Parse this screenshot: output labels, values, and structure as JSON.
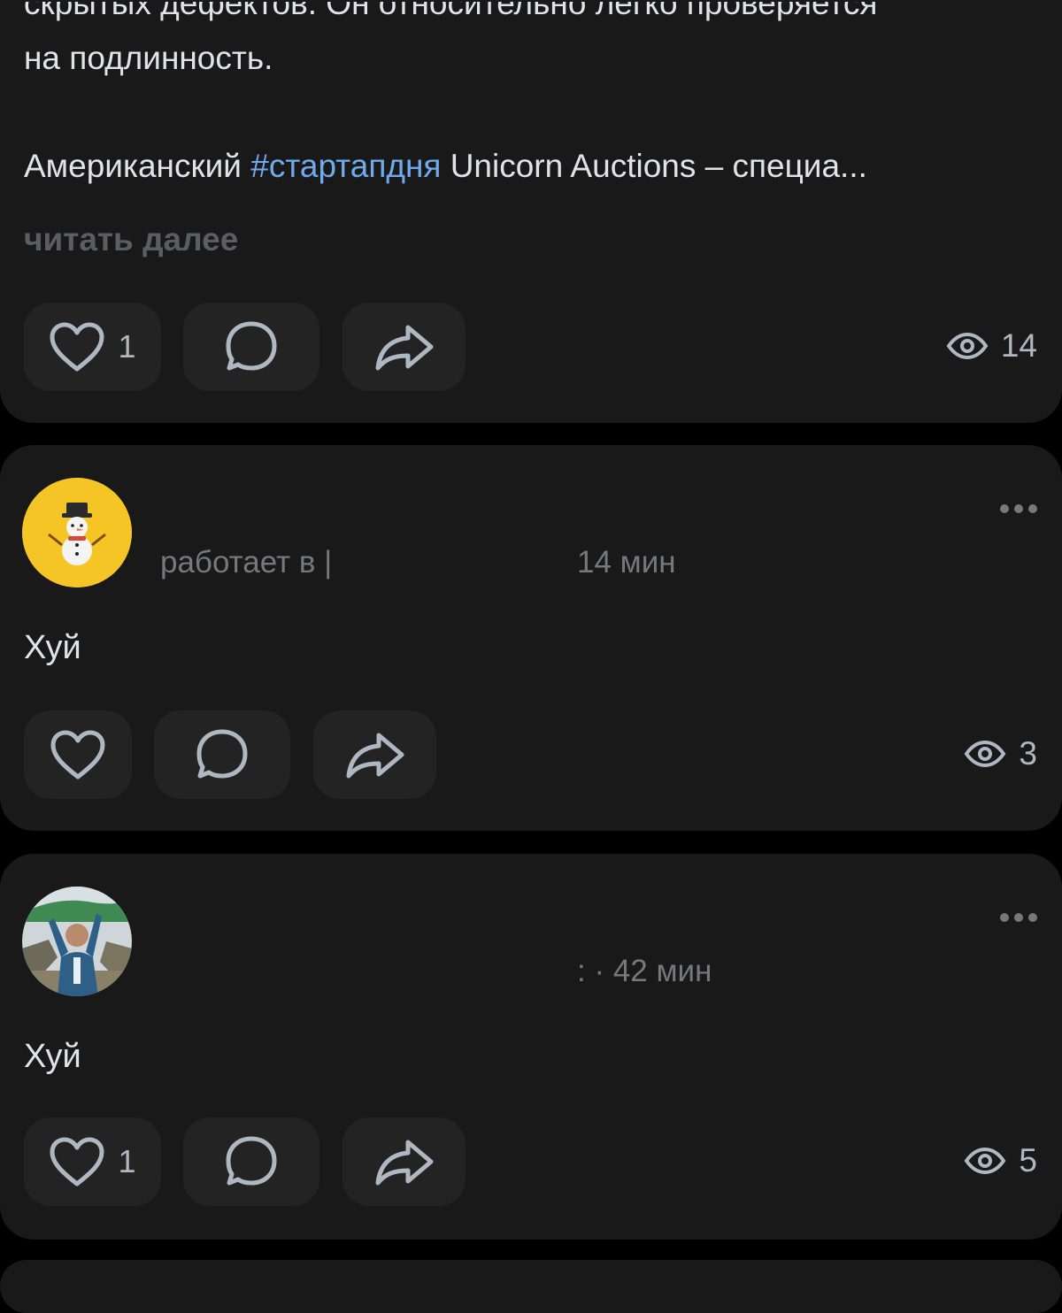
{
  "posts": [
    {
      "text_line_partial": "скрытых дефектов. Он относительно легко проверяется",
      "text_line1": "на подлинность.",
      "text_line2_before": "Американский ",
      "hashtag": "#стартапдня",
      "text_line2_after": " Unicorn Auctions – специа...",
      "read_more": "читать далее",
      "likes": "1",
      "views": "14"
    },
    {
      "meta_status": "работает в |",
      "meta_time": "14 мин",
      "text": "Хуй",
      "likes": "",
      "views": "3"
    },
    {
      "meta_time": ": · 42 мин",
      "text": "Хуй",
      "likes": "1",
      "views": "5"
    }
  ],
  "icons": {
    "like": "heart-outline-icon",
    "comment": "comment-bubble-icon",
    "share": "share-arrow-icon",
    "views": "eye-icon",
    "more": "more-dots-icon"
  },
  "colors": {
    "background": "#000000",
    "card": "#19191a",
    "button": "#232324",
    "text": "#e1e3e6",
    "secondary_text": "#76787a",
    "hashtag": "#71aaeb",
    "icon": "#aeb7c2"
  }
}
